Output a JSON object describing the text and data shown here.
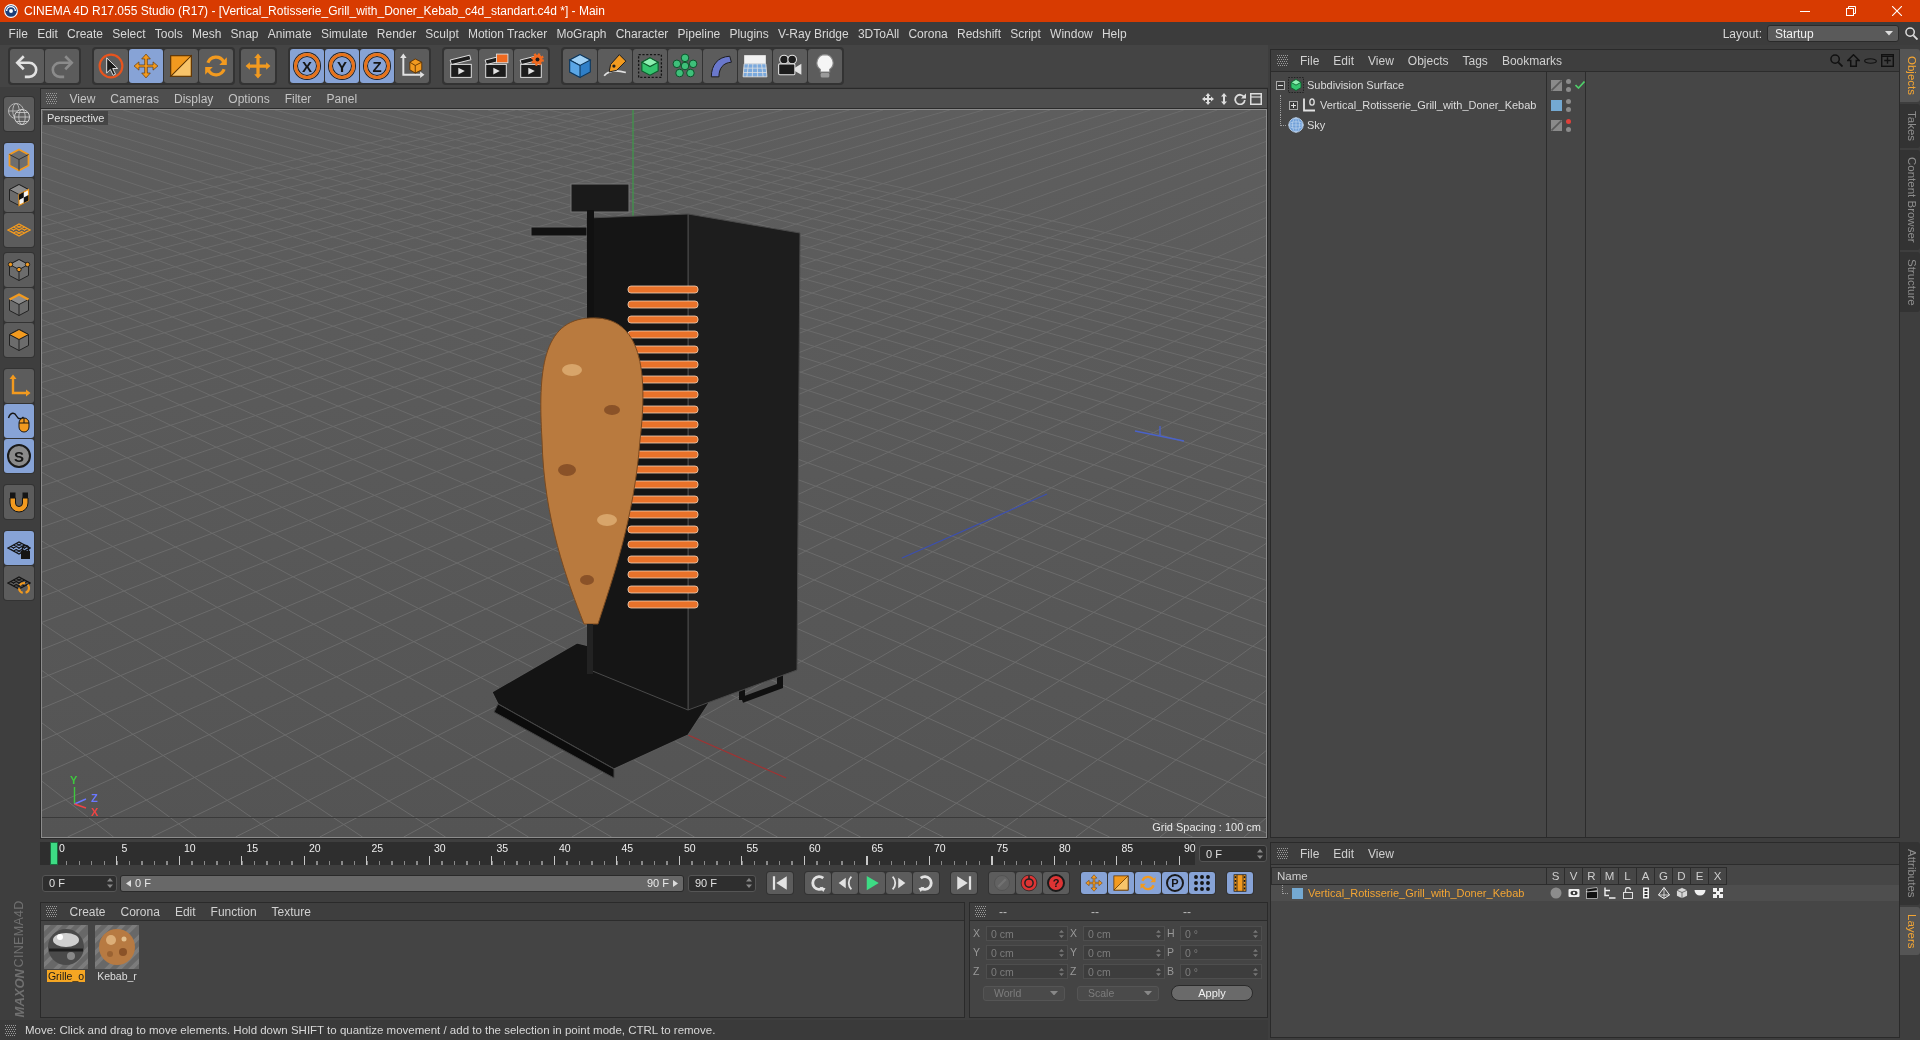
{
  "window": {
    "title": "CINEMA 4D R17.055 Studio (R17) - [Vertical_Rotisserie_Grill_with_Doner_Kebab_c4d_standart.c4d *] - Main"
  },
  "menu_bar": {
    "items": [
      "File",
      "Edit",
      "Create",
      "Select",
      "Tools",
      "Mesh",
      "Snap",
      "Animate",
      "Simulate",
      "Render",
      "Sculpt",
      "Motion Tracker",
      "MoGraph",
      "Character",
      "Pipeline",
      "Plugins",
      "V-Ray Bridge",
      "3DToAll",
      "Corona",
      "Redshift",
      "Script",
      "Window",
      "Help"
    ]
  },
  "layout": {
    "label": "Layout:",
    "value": "Startup"
  },
  "toolbar": {
    "groups": [
      {
        "buttons": [
          {
            "kind": "undo",
            "disabled": false
          },
          {
            "kind": "redo",
            "disabled": true
          }
        ]
      },
      {
        "buttons": [
          {
            "kind": "live_selection",
            "selected": false
          },
          {
            "kind": "move",
            "selected": true
          },
          {
            "kind": "scale",
            "selected": false
          },
          {
            "kind": "rotate",
            "selected": false
          }
        ]
      },
      {
        "buttons": [
          {
            "kind": "last_tool",
            "selected": false
          }
        ]
      },
      {
        "buttons": [
          {
            "kind": "axis_x",
            "label": "X",
            "selected": true
          },
          {
            "kind": "axis_y",
            "label": "Y",
            "selected": true
          },
          {
            "kind": "axis_z",
            "label": "Z",
            "selected": true
          },
          {
            "kind": "coordinate_system",
            "selected": false
          }
        ]
      },
      {
        "buttons": [
          {
            "kind": "render_view"
          },
          {
            "kind": "render_viewer"
          },
          {
            "kind": "render_settings"
          }
        ]
      },
      {
        "buttons": [
          {
            "kind": "cube"
          },
          {
            "kind": "pen"
          },
          {
            "kind": "subdivision"
          },
          {
            "kind": "cloner"
          },
          {
            "kind": "bend"
          },
          {
            "kind": "floor"
          },
          {
            "kind": "camera"
          },
          {
            "kind": "light"
          }
        ]
      }
    ]
  },
  "left_toolbar": {
    "groups": [
      {
        "buttons": [
          {
            "kind": "make_editable",
            "selected": false
          }
        ]
      },
      {
        "buttons": [
          {
            "kind": "model",
            "selected": true
          },
          {
            "kind": "texture",
            "selected": false
          },
          {
            "kind": "workplane",
            "selected": false
          }
        ]
      },
      {
        "buttons": [
          {
            "kind": "points",
            "selected": false
          },
          {
            "kind": "edges",
            "selected": false
          },
          {
            "kind": "polygons",
            "selected": false
          }
        ]
      },
      {
        "buttons": [
          {
            "kind": "axis",
            "selected": false
          },
          {
            "kind": "tweak",
            "selected": true
          },
          {
            "kind": "snap",
            "label": "S",
            "selected": true
          }
        ]
      },
      {
        "buttons": [
          {
            "kind": "magnet",
            "selected": false
          }
        ]
      },
      {
        "buttons": [
          {
            "kind": "workplane_lock",
            "selected": true
          },
          {
            "kind": "workplane_sync",
            "selected": false
          }
        ]
      }
    ]
  },
  "logo": {
    "brand": "MAXON",
    "product": "CINEMA4D"
  },
  "viewport": {
    "menu": [
      "View",
      "Cameras",
      "Display",
      "Options",
      "Filter",
      "Panel"
    ],
    "camera": "Perspective",
    "grid_spacing": "Grid Spacing : 100 cm",
    "axes": [
      {
        "label": "Y",
        "color": "#3ec83e"
      },
      {
        "label": "Z",
        "color": "#6a78ff"
      },
      {
        "label": "X",
        "color": "#f04444"
      }
    ]
  },
  "timeline": {
    "labels": [
      "0",
      "5",
      "10",
      "15",
      "20",
      "25",
      "30",
      "35",
      "40",
      "45",
      "50",
      "55",
      "60",
      "65",
      "70",
      "75",
      "80",
      "85",
      "90"
    ],
    "level": 0,
    "current_frame": "0 F"
  },
  "transport": {
    "start_frame": "0 F",
    "range": {
      "start": "0 F",
      "end": "90 F",
      "level": 1
    },
    "end_frame": "90 F",
    "groups": [
      {
        "buttons": [
          {
            "kind": "go_start"
          }
        ]
      },
      {
        "buttons": [
          {
            "kind": "prev_key"
          },
          {
            "kind": "prev_frame"
          },
          {
            "kind": "play"
          },
          {
            "kind": "next_frame"
          },
          {
            "kind": "next_key"
          }
        ]
      },
      {
        "buttons": [
          {
            "kind": "go_end"
          }
        ]
      },
      {
        "buttons": [
          {
            "kind": "record",
            "disabled": true
          },
          {
            "kind": "autokey",
            "disabled": false
          },
          {
            "kind": "key_help",
            "label": "?",
            "disabled": false
          }
        ]
      },
      {
        "buttons": [
          {
            "kind": "key_move",
            "selected": true
          },
          {
            "kind": "key_scale",
            "selected": true
          },
          {
            "kind": "key_rotate",
            "selected": true
          },
          {
            "kind": "key_param",
            "label": "P",
            "selected": true
          },
          {
            "kind": "key_points",
            "selected": true
          }
        ]
      },
      {
        "buttons": [
          {
            "kind": "timeline_window",
            "selected": true
          }
        ]
      }
    ]
  },
  "material_manager": {
    "menu": [
      "Create",
      "Corona",
      "Edit",
      "Function",
      "Texture"
    ],
    "materials": [
      {
        "name": "Grille_o",
        "kind": "chrome",
        "selected": true
      },
      {
        "name": "Kebab_r",
        "kind": "kebab",
        "selected": false
      }
    ]
  },
  "coordinates": {
    "headers": [
      "--",
      "--",
      "--"
    ],
    "rows": [
      [
        {
          "label": "X",
          "value": "0 cm"
        },
        {
          "label": "X",
          "value": "0 cm"
        },
        {
          "label": "H",
          "value": "0 °"
        }
      ],
      [
        {
          "label": "Y",
          "value": "0 cm"
        },
        {
          "label": "Y",
          "value": "0 cm"
        },
        {
          "label": "P",
          "value": "0 °"
        }
      ],
      [
        {
          "label": "Z",
          "value": "0 cm"
        },
        {
          "label": "Z",
          "value": "0 cm"
        },
        {
          "label": "B",
          "value": "0 °"
        }
      ]
    ],
    "dropdowns": [
      "World",
      "Scale"
    ],
    "apply": "Apply",
    "disabled": true
  },
  "status_bar": {
    "text": "Move: Click and drag to move elements. Hold down SHIFT to quantize movement / add to the selection in point mode, CTRL to remove."
  },
  "object_manager": {
    "menu": [
      "File",
      "Edit",
      "View",
      "Objects",
      "Tags",
      "Bookmarks"
    ],
    "objects": [
      {
        "name": "Subdivision Surface",
        "kind": "subdivision",
        "expanded": true,
        "visibility": [
          {
            "color": "#8b8b8b"
          },
          {
            "color": "#8b8b8b"
          }
        ],
        "enabled": true,
        "children": [
          {
            "name": "Vertical_Rotisserie_Grill_with_Doner_Kebab",
            "kind": "null",
            "expanded": false,
            "color": "#74a9d2",
            "visibility": [
              {
                "color": "#8b8b8b"
              },
              {
                "color": "#8b8b8b"
              }
            ]
          }
        ]
      },
      {
        "name": "Sky",
        "kind": "sky",
        "visibility": [
          {
            "color": "#e2403a"
          },
          {
            "color": "#8b8b8b"
          }
        ]
      }
    ]
  },
  "layer_manager": {
    "menu": [
      "File",
      "Edit",
      "View"
    ],
    "columns": [
      "Name",
      "S",
      "V",
      "R",
      "M",
      "L",
      "A",
      "G",
      "D",
      "E",
      "X"
    ],
    "layers": [
      {
        "name": "Vertical_Rotisserie_Grill_with_Doner_Kebab",
        "color": "#74a9d2",
        "selected": true,
        "flags": [
          {
            "kind": "solo",
            "on": false
          },
          {
            "kind": "visible",
            "on": true
          },
          {
            "kind": "render",
            "on": true
          },
          {
            "kind": "manager",
            "on": true
          },
          {
            "kind": "locked",
            "on": false
          },
          {
            "kind": "animation",
            "on": true
          },
          {
            "kind": "generators",
            "on": true
          },
          {
            "kind": "deformers",
            "on": true
          },
          {
            "kind": "expressions",
            "on": true
          },
          {
            "kind": "xref",
            "on": true
          }
        ]
      }
    ]
  },
  "side_tabs": {
    "top": [
      {
        "label": "Objects",
        "selected": true
      },
      {
        "label": "Takes",
        "selected": false
      },
      {
        "label": "Content Browser",
        "selected": false
      },
      {
        "label": "Structure",
        "selected": false
      }
    ],
    "bottom": [
      {
        "label": "Attributes",
        "selected": false
      },
      {
        "label": "Layers",
        "selected": true
      }
    ]
  }
}
